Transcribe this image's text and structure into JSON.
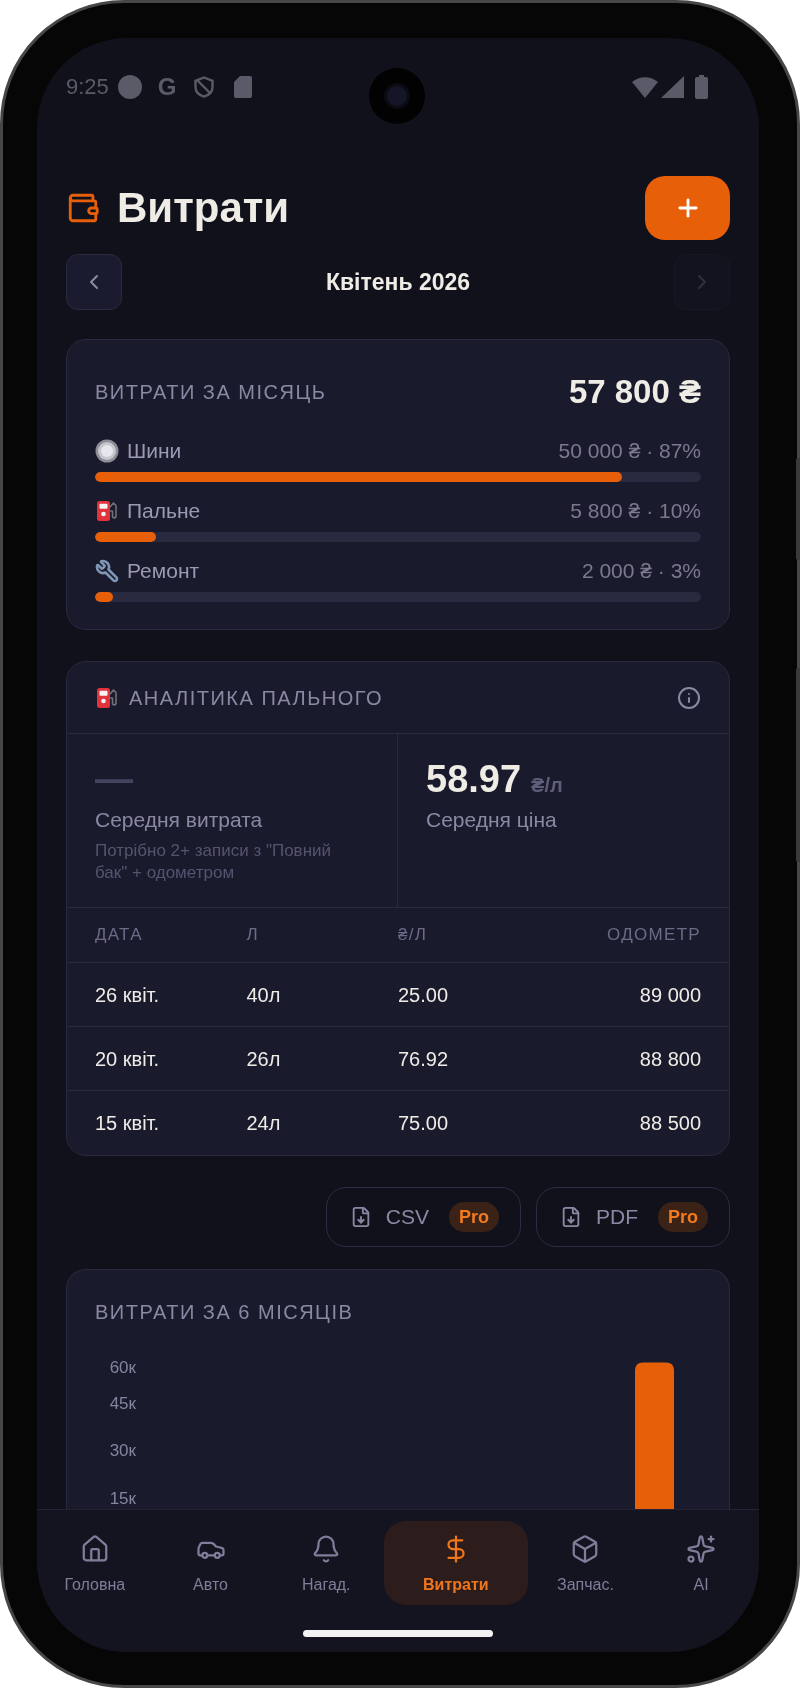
{
  "status_bar": {
    "time": "9:25",
    "app_letter": "G"
  },
  "header": {
    "title": "Витрати"
  },
  "month_nav": {
    "label": "Квітень 2026",
    "prev": {
      "disabled": false
    },
    "next": {
      "disabled": true
    }
  },
  "monthly_summary": {
    "title": "ВИТРАТИ ЗА МІСЯЦЬ",
    "total": "57 800 ₴",
    "categories": [
      {
        "name": "Шини",
        "amount": "50 000 ₴ · 87%",
        "level": 0.87
      },
      {
        "name": "Пальне",
        "amount": "5 800 ₴ · 10%",
        "level": 0.1
      },
      {
        "name": "Ремонт",
        "amount": "2 000 ₴ · 3%",
        "level": 0.03
      }
    ]
  },
  "fuel_analytics": {
    "title": "АНАЛІТИКА ПАЛЬНОГО",
    "stats": [
      {
        "kind": "empty",
        "value": "—",
        "label": "Середня витрата",
        "hint": "Потрібно 2+ записи з \"Повний бак\" + одометром"
      },
      {
        "kind": "value",
        "value": "58.97",
        "unit": "₴/л",
        "label": "Середня ціна"
      }
    ],
    "table": {
      "columns": [
        "ДАТА",
        "Л",
        "₴/Л",
        "ОДОМЕТР"
      ],
      "rows": [
        [
          "26 квіт.",
          "40л",
          "25.00",
          "89 000"
        ],
        [
          "20 квіт.",
          "26л",
          "76.92",
          "88 800"
        ],
        [
          "15 квіт.",
          "24л",
          "75.00",
          "88 500"
        ]
      ]
    }
  },
  "export_buttons": [
    {
      "label": "CSV",
      "badge": "Pro"
    },
    {
      "label": "PDF",
      "badge": "Pro"
    }
  ],
  "six_month_chart": {
    "title": "ВИТРАТИ ЗА 6 МІСЯЦІВ",
    "y_axis_labels": [
      "60к",
      "45к",
      "30к",
      "15к"
    ]
  },
  "bottom_nav": [
    {
      "label": "Головна",
      "selected": false
    },
    {
      "label": "Авто",
      "selected": false
    },
    {
      "label": "Нагад.",
      "selected": false
    },
    {
      "label": "Витрати",
      "selected": true
    },
    {
      "label": "Запчас.",
      "selected": false
    },
    {
      "label": "AI",
      "selected": false
    }
  ]
}
